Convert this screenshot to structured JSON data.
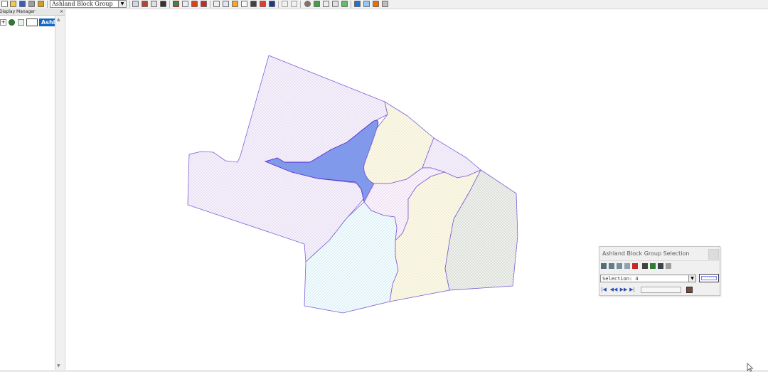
{
  "toolbar": {
    "active_layer": "Ashland Block Group",
    "tools": [
      "new-file-icon",
      "open-folder-icon",
      "save-icon",
      "print-icon",
      "print-preview-icon",
      "table-icon",
      "layout-icon",
      "scissors-icon",
      "binoculars-icon",
      "theme-icon",
      "grid-icon",
      "sparkle-icon",
      "flag-icon",
      "stack-icon",
      "document-icon",
      "pin-icon",
      "pan-icon",
      "zoom-extent-icon",
      "flag-red-icon",
      "flag-blue-icon",
      "undo-icon",
      "redo-icon",
      "target-icon",
      "frame-icon",
      "arrow-icon",
      "pencil-icon",
      "picture-icon",
      "network-icon",
      "layers-icon",
      "edit-icon",
      "shape-icon"
    ]
  },
  "display_manager": {
    "title": "Display Manager",
    "close": "×",
    "layer_label": "Ashland Block Group"
  },
  "selection_window": {
    "title": "Ashland Block Group Selection",
    "selection_value": "Selection: 4",
    "tools": [
      "select-pointer-icon",
      "select-zoom-icon",
      "select-add-icon",
      "select-remove-icon",
      "clear-selection-icon",
      "add-record-icon",
      "database-icon",
      "zoom-to-selection-icon",
      "grid-view-icon"
    ],
    "nav": [
      "|◀",
      "◀◀",
      "▶▶",
      "▶|"
    ]
  },
  "colors": {
    "selected_fill": "#8199ea",
    "selected_outline": "#5a2fcf",
    "polygon_outline": "#7b5fd6",
    "layer_tag": "#1565c0"
  }
}
